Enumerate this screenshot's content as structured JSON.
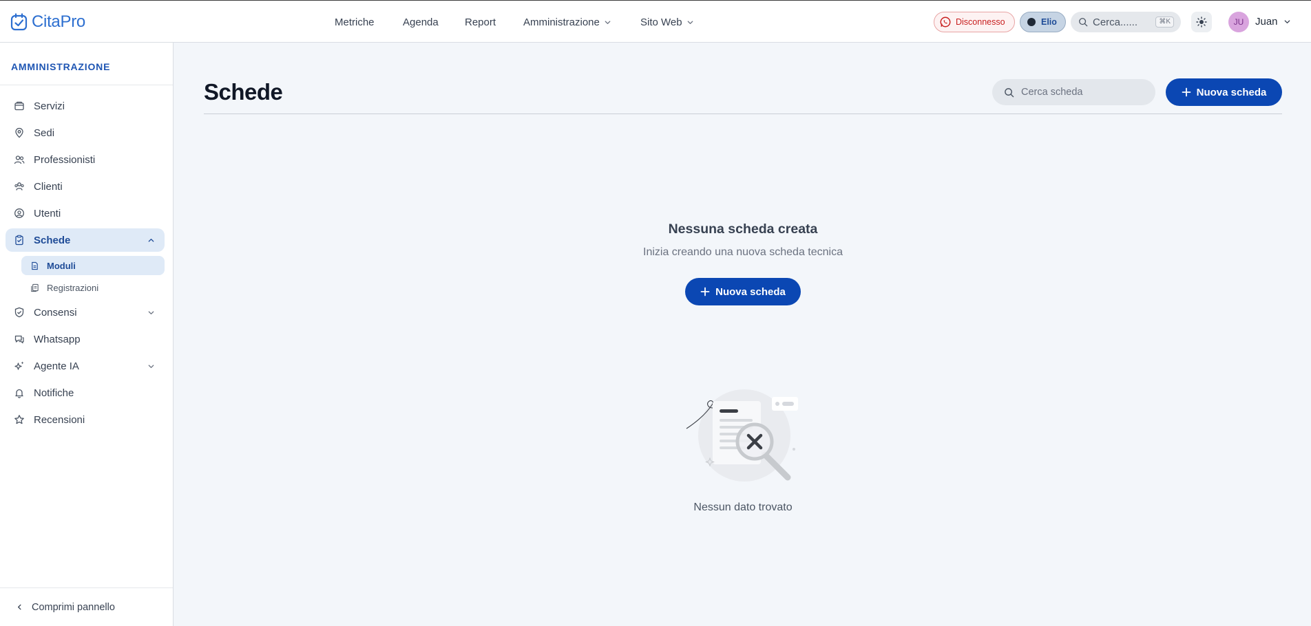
{
  "app": {
    "logo_text": "CitaPro"
  },
  "topnav": {
    "items": [
      "Metriche",
      "Agenda",
      "Report",
      "Amministrazione",
      "Sito Web"
    ],
    "whatsapp_status": "Disconnesso",
    "assistant_name": "Elio",
    "search_placeholder": "Cerca......",
    "search_shortcut": "⌘K",
    "user_initials": "JU",
    "user_name": "Juan"
  },
  "sidebar": {
    "section_title": "AMMINISTRAZIONE",
    "items": [
      {
        "label": "Servizi",
        "icon": "box-icon"
      },
      {
        "label": "Sedi",
        "icon": "map-pin-icon"
      },
      {
        "label": "Professionisti",
        "icon": "users-icon"
      },
      {
        "label": "Clienti",
        "icon": "group-icon"
      },
      {
        "label": "Utenti",
        "icon": "user-circle-icon"
      },
      {
        "label": "Schede",
        "icon": "clipboard-icon",
        "expanded": true,
        "active": true
      },
      {
        "label": "Consensi",
        "icon": "shield-icon",
        "expandable": true
      },
      {
        "label": "Whatsapp",
        "icon": "chat-icon"
      },
      {
        "label": "Agente IA",
        "icon": "sparkles-icon",
        "expandable": true
      },
      {
        "label": "Notifiche",
        "icon": "bell-icon"
      },
      {
        "label": "Recensioni",
        "icon": "star-icon"
      }
    ],
    "subitems": [
      {
        "label": "Moduli",
        "icon": "document-icon",
        "active": true
      },
      {
        "label": "Registrazioni",
        "icon": "documents-icon"
      }
    ],
    "collapse_label": "Comprimi pannello"
  },
  "main": {
    "title": "Schede",
    "search_placeholder": "Cerca scheda",
    "new_button_label": "Nuova scheda",
    "empty_title": "Nessuna scheda creata",
    "empty_subtitle": "Inizia creando una nuova scheda tecnica",
    "empty_button_label": "Nuova scheda",
    "no_data_text": "Nessun dato trovato"
  },
  "colors": {
    "primary": "#0b47b3",
    "accent_text": "#1e55b3",
    "active_bg": "#dfeaf7",
    "page_bg": "#f3f6fa"
  }
}
